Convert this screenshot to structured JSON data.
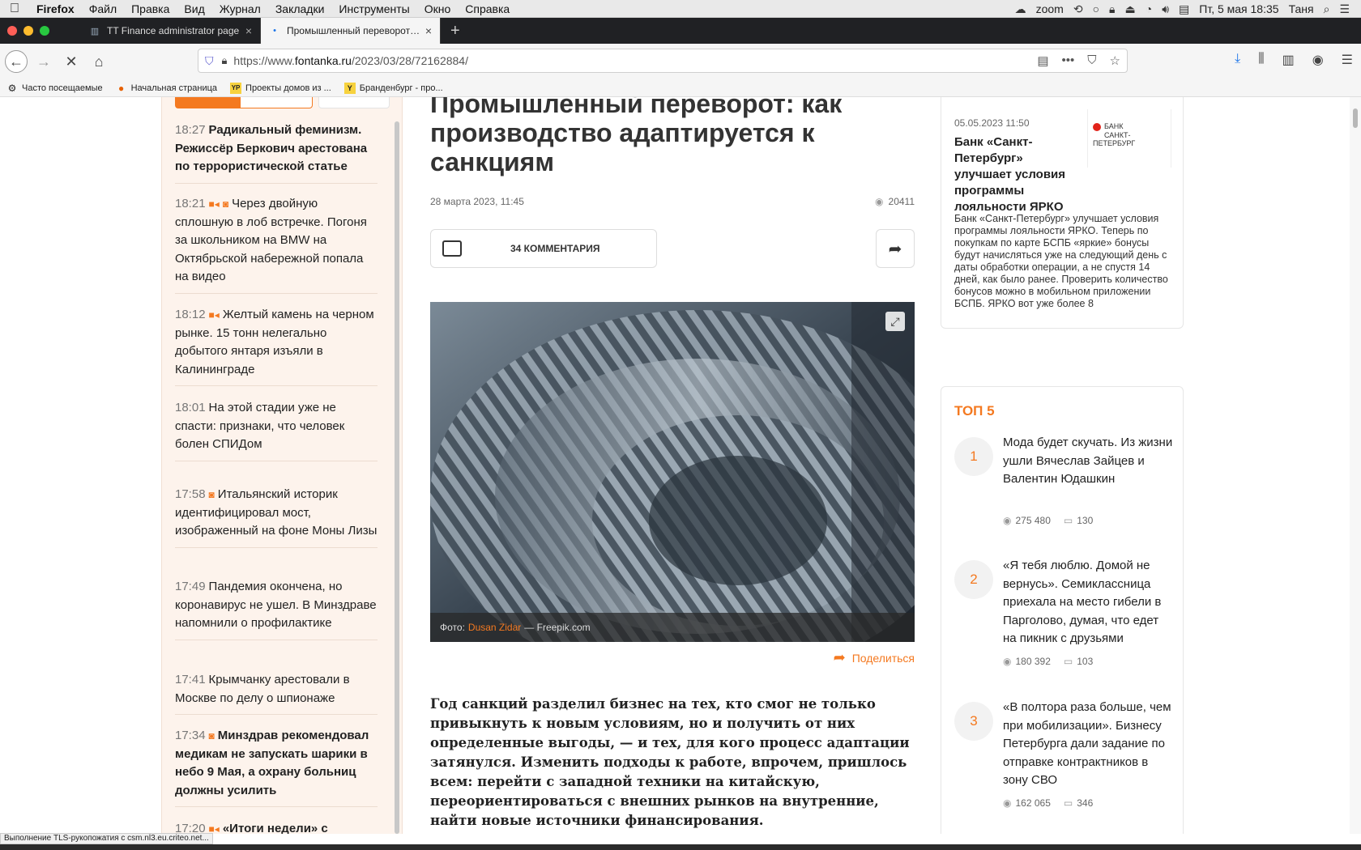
{
  "menubar": {
    "apple": "",
    "app": "Firefox",
    "items": [
      "Файл",
      "Правка",
      "Вид",
      "Журнал",
      "Закладки",
      "Инструменты",
      "Окно",
      "Справка"
    ],
    "zoom": "zoom",
    "datetime": "Пт, 5 мая  18:35",
    "user": "Таня"
  },
  "tabs": [
    {
      "label": "TT Finance administrator page",
      "close": "×"
    },
    {
      "label": "Промышленный переворот: как",
      "close": "×"
    }
  ],
  "newtab": "+",
  "navbar": {
    "url_prefix": "https://www.",
    "url_domain": "fontanka.ru",
    "url_path": "/2023/03/28/72162884/"
  },
  "bookmarks": [
    "Часто посещаемые",
    "Начальная страница",
    "Проекты домов из ...",
    "Бранденбург - про..."
  ],
  "feed": {
    "items": [
      {
        "time": "18:27",
        "text": "Радикальный феминизм. Режиссёр Беркович арестована по террористической статье",
        "bold": true,
        "marks": []
      },
      {
        "time": "18:21",
        "text": "Через двойную сплошную в лоб встречке. Погоня за школьником на BMW на Октябрьской набережной попала на видео",
        "bold": false,
        "marks": [
          "video",
          "photo"
        ]
      },
      {
        "time": "18:12",
        "text": "Желтый камень на черном рынке. 15 тонн нелегально добытого янтаря изъяли в Калининграде",
        "bold": false,
        "marks": [
          "video"
        ]
      },
      {
        "time": "18:01",
        "text": "На этой стадии уже не спасти: признаки, что человек болен СПИДом",
        "bold": false,
        "marks": []
      },
      {
        "time": "17:58",
        "text": "Итальянский историк идентифицировал мост, изображенный на фоне Моны Лизы",
        "bold": false,
        "marks": [
          "photo"
        ]
      },
      {
        "time": "17:49",
        "text": "Пандемия окончена, но коронавирус не ушел. В Минздраве напомнили о профилактике",
        "bold": false,
        "marks": []
      },
      {
        "time": "17:41",
        "text": "Крымчанку арестовали в Москве по делу о шпионаже",
        "bold": false,
        "marks": []
      },
      {
        "time": "17:34",
        "text": "Минздрав рекомендовал медикам не запускать шарики в небо 9 Мая, а охрану больниц должны усилить",
        "bold": true,
        "marks": [
          "photo"
        ]
      },
      {
        "time": "17:20",
        "text": "«Итоги недели» с",
        "bold": true,
        "marks": [
          "video"
        ]
      }
    ]
  },
  "article": {
    "title": "Промышленный переворот: как производство адаптируется к санкциям",
    "date": "28 марта 2023, 11:45",
    "views": "20411",
    "comments_label": "34 КОММЕНТАРИЯ",
    "photo_caption_prefix": "Фото:",
    "photo_author": "Dusan Zidar",
    "photo_caption_suffix": "— Freepik.com",
    "share_label": "Поделиться",
    "lead": "Год санкций разделил бизнес на тех, кто смог не только привыкнуть к новым условиям, но и получить от них определенные выгоды, — и тех, для кого процесс адаптации затянулся. Изменить подходы к работе, впрочем, пришлось всем: перейти с западной техники на китайскую, переориентироваться с внешних рынков на внутренние, найти новые источники финансирования."
  },
  "promo": {
    "date": "05.05.2023 11:50",
    "title": "Банк «Санкт-Петербург» улучшает условия программы лояльности ЯРКО",
    "logo_line1": "БАНК",
    "logo_line2": "САНКТ-ПЕТЕРБУРГ",
    "text": "Банк «Санкт-Петербург» улучшает условия программы лояльности ЯРКО. Теперь по покупкам по карте БСПБ «яркие» бонусы будут начисляться уже на следующий день с даты обработки операции, а не спустя 14 дней, как было ранее. Проверить количество бонусов можно в мобильном приложении БСПБ. ЯРКО вот уже более 8"
  },
  "top5": {
    "heading": "ТОП 5",
    "items": [
      {
        "rank": "1",
        "text": "Мода будет скучать. Из жизни ушли Вячеслав Зайцев и Валентин Юдашкин",
        "views": "275 480",
        "comments": "130"
      },
      {
        "rank": "2",
        "text": "«Я тебя люблю. Домой не вернусь». Семиклассница приехала на место гибели в Парголово, думая, что едет на пикник с друзьями",
        "views": "180 392",
        "comments": "103"
      },
      {
        "rank": "3",
        "text": "«В полтора раза больше, чем при мобилизации». Бизнесу Петербурга дали задание по отправке контрактников в зону СВО",
        "views": "162 065",
        "comments": "346"
      }
    ]
  },
  "status": "Выполнение TLS-рукопожатия с csm.nl3.eu.criteo.net...",
  "colors": {
    "accent": "#f47920",
    "feed_bg": "#fdf3ec"
  }
}
